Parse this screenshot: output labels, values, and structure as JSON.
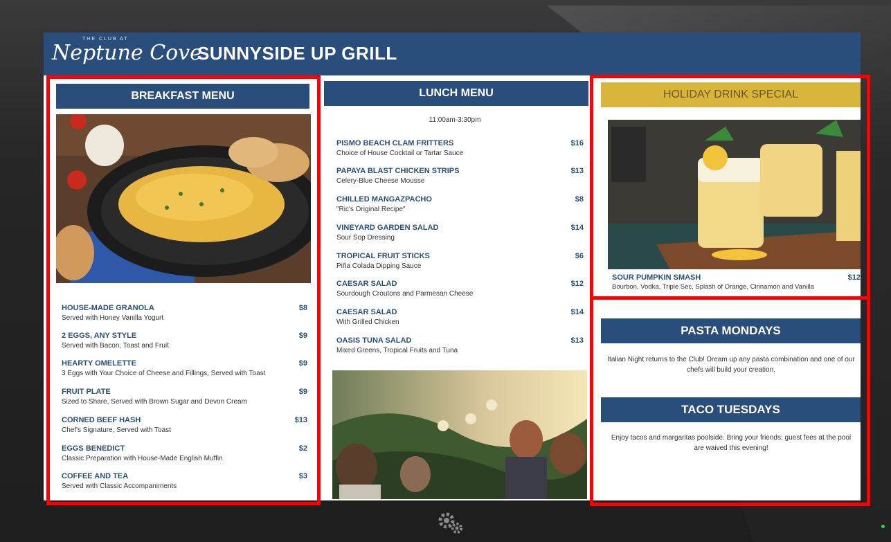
{
  "brand": {
    "logo_small": "THE CLUB AT",
    "logo_script": "Neptune Cove"
  },
  "header": {
    "title": "SUNNYSIDE UP GRILL"
  },
  "breakfast": {
    "title": "BREAKFAST MENU",
    "items": [
      {
        "name": "HOUSE-MADE GRANOLA",
        "price": "$8",
        "desc": "Served with Honey Vanilla Yogurt"
      },
      {
        "name": "2 EGGS, ANY STYLE",
        "price": "$9",
        "desc": "Served with Bacon, Toast and Fruit"
      },
      {
        "name": "HEARTY OMELETTE",
        "price": "$9",
        "desc": "3 Eggs with Your Choice of Cheese and Fillings, Served with Toast"
      },
      {
        "name": "FRUIT PLATE",
        "price": "$9",
        "desc": "Sized to Share, Served with Brown Sugar and Devon Cream"
      },
      {
        "name": "CORNED BEEF HASH",
        "price": "$13",
        "desc": "Chef's Signature, Served with Toast"
      },
      {
        "name": "EGGS BENEDICT",
        "price": "$2",
        "desc": "Classic Preparation with House-Made English Muffin"
      },
      {
        "name": "COFFEE AND TEA",
        "price": "$3",
        "desc": "Served with Classic Accompaniments"
      }
    ]
  },
  "lunch": {
    "title": "LUNCH MENU",
    "hours": "11:00am-3:30pm",
    "items": [
      {
        "name": "PISMO BEACH CLAM FRITTERS",
        "price": "$16",
        "desc": "Choice of House Cocktail or Tartar Sauce"
      },
      {
        "name": "PAPAYA BLAST CHICKEN STRIPS",
        "price": "$13",
        "desc": "Celery-Blue Cheese Mousse"
      },
      {
        "name": "CHILLED MANGAZPACHO",
        "price": "$8",
        "desc": "\"Ric's Original Recipe\""
      },
      {
        "name": "VINEYARD GARDEN SALAD",
        "price": "$14",
        "desc": "Sour Sop Dressing"
      },
      {
        "name": "TROPICAL FRUIT STICKS",
        "price": "$6",
        "desc": "Piña Colada Dipping Sauce"
      },
      {
        "name": "CAESAR SALAD",
        "price": "$12",
        "desc": "Sourdough Croutons and Parmesan Cheese"
      },
      {
        "name": "CAESAR SALAD",
        "price": "$14",
        "desc": "With Grilled Chicken"
      },
      {
        "name": "OASIS TUNA SALAD",
        "price": "$13",
        "desc": "Mixed Greens, Tropical Fruits and Tuna"
      }
    ]
  },
  "drink": {
    "title": "HOLIDAY DRINK SPECIAL",
    "name": "SOUR PUMPKIN SMASH",
    "price": "$12",
    "desc": "Bourbon, Vodka, Triple Sec, Splash of Orange, Cinnamon and Vanilla"
  },
  "promos": [
    {
      "title": "PASTA MONDAYS",
      "text": "Italian Night returns to the Club! Dream up any pasta combination and one of our chefs will build your creation."
    },
    {
      "title": "TACO TUESDAYS",
      "text": "Enjoy tacos and margaritas poolside. Bring your friends; guest fees at the pool are waived this evening!"
    }
  ],
  "icons": {
    "settings": "gears-icon"
  },
  "colors": {
    "brand_blue": "#2a4e7c",
    "gold": "#d9b53a",
    "highlight": "#ff0000"
  }
}
